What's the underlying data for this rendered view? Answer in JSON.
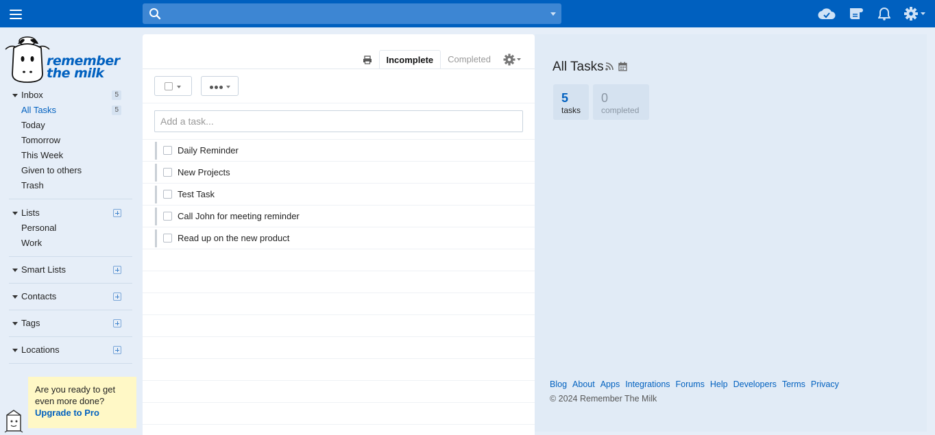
{
  "topbar": {
    "search_placeholder": "",
    "icons": [
      "menu-icon",
      "search-icon",
      "sync-cloud-icon",
      "notes-icon",
      "bell-icon",
      "gear-icon"
    ]
  },
  "logo": {
    "line1": "remember",
    "line2": "the milk"
  },
  "sidebar": {
    "inbox": {
      "label": "Inbox",
      "count": "5",
      "items": [
        {
          "label": "All Tasks",
          "count": "5"
        },
        {
          "label": "Today"
        },
        {
          "label": "Tomorrow"
        },
        {
          "label": "This Week"
        },
        {
          "label": "Given to others"
        },
        {
          "label": "Trash"
        }
      ]
    },
    "lists": {
      "label": "Lists",
      "items": [
        {
          "label": "Personal"
        },
        {
          "label": "Work"
        }
      ]
    },
    "smart_lists": {
      "label": "Smart Lists"
    },
    "contacts": {
      "label": "Contacts"
    },
    "tags": {
      "label": "Tags"
    },
    "locations": {
      "label": "Locations"
    }
  },
  "promo": {
    "text": "Are you ready to get even more done?",
    "link": "Upgrade to Pro"
  },
  "tasklist": {
    "tabs": {
      "incomplete": "Incomplete",
      "completed": "Completed"
    },
    "add_placeholder": "Add a task...",
    "tasks": [
      {
        "name": "Daily Reminder"
      },
      {
        "name": "New Projects"
      },
      {
        "name": "Test Task"
      },
      {
        "name": "Call John for meeting reminder"
      },
      {
        "name": "Read up on the new product"
      }
    ]
  },
  "details": {
    "title": "All Tasks",
    "stats": {
      "tasks_num": "5",
      "tasks_label": "tasks",
      "completed_num": "0",
      "completed_label": "completed"
    },
    "footer_links": [
      "Blog",
      "About",
      "Apps",
      "Integrations",
      "Forums",
      "Help",
      "Developers",
      "Terms",
      "Privacy"
    ],
    "copyright": "© 2024 Remember The Milk"
  },
  "colors": {
    "brand": "#0060bf",
    "search_bg": "#3d86d3",
    "promo_bg": "#fff8c6",
    "panel_bg": "#e1ebf6"
  }
}
